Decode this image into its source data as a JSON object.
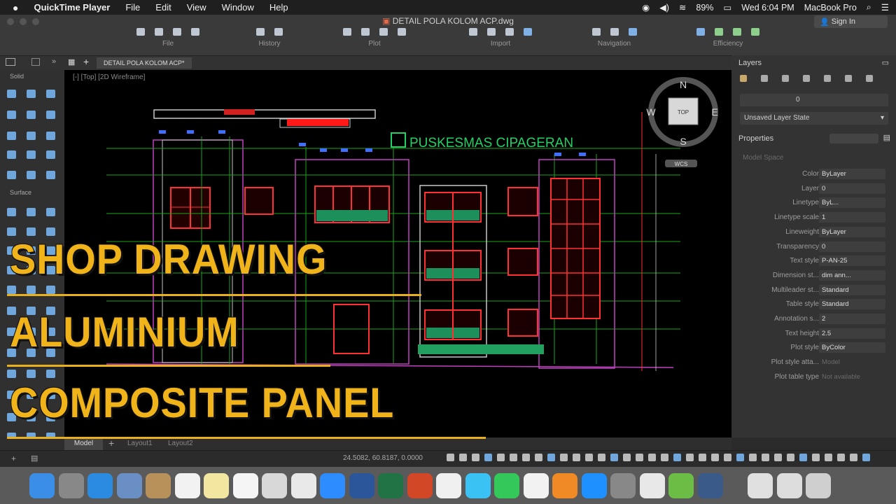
{
  "menubar": {
    "apple": "",
    "app_name": "QuickTime Player",
    "items": [
      "File",
      "Edit",
      "View",
      "Window",
      "Help"
    ],
    "battery": "89%",
    "clock": "Wed 6:04 PM",
    "computer": "MacBook Pro"
  },
  "window": {
    "title": "DETAIL POLA KOLOM ACP.dwg",
    "signin": "Sign In"
  },
  "toolbar": {
    "groups": [
      "File",
      "History",
      "Plot",
      "Import",
      "Navigation",
      "Efficiency"
    ]
  },
  "tabs": {
    "document": "DETAIL POLA KOLOM ACP*"
  },
  "viewport": {
    "label": "[-] [Top] [2D Wireframe]",
    "building_sign": "PUSKESMAS CIPAGERAN",
    "viewcube": {
      "n": "N",
      "s": "S",
      "e": "E",
      "w": "W",
      "top": "TOP"
    },
    "wcs": "WCS"
  },
  "left_palette": {
    "solid": "Solid",
    "surface": "Surface"
  },
  "layers_panel": {
    "title": "Layers",
    "current_layer": "0",
    "layer_state": "Unsaved Layer State"
  },
  "properties_panel": {
    "title": "Properties",
    "model_space": "Model Space",
    "rows": [
      {
        "label": "Color",
        "value": "ByLayer",
        "disabled": false
      },
      {
        "label": "Layer",
        "value": "0",
        "disabled": false
      },
      {
        "label": "Linetype",
        "value": "ByL...",
        "disabled": false
      },
      {
        "label": "Linetype scale",
        "value": "1",
        "disabled": false
      },
      {
        "label": "Lineweight",
        "value": "ByLayer",
        "disabled": false
      },
      {
        "label": "Transparency",
        "value": "0",
        "disabled": false
      },
      {
        "label": "Text style",
        "value": "P-AN-25",
        "disabled": false
      },
      {
        "label": "Dimension st...",
        "value": "dim ann...",
        "disabled": false
      },
      {
        "label": "Multileader st...",
        "value": "Standard",
        "disabled": false
      },
      {
        "label": "Table style",
        "value": "Standard",
        "disabled": false
      },
      {
        "label": "Annotation s...",
        "value": "2",
        "disabled": false
      },
      {
        "label": "Text height",
        "value": "2.5",
        "disabled": false
      },
      {
        "label": "Plot style",
        "value": "ByColor",
        "disabled": false
      },
      {
        "label": "Plot style atta...",
        "value": "Model",
        "disabled": true
      },
      {
        "label": "Plot table type",
        "value": "Not available",
        "disabled": true
      }
    ]
  },
  "layout_tabs": [
    "Model",
    "Layout1",
    "Layout2"
  ],
  "status": {
    "coordinates": "24.5082, 60.8187, 0.0000"
  },
  "overlay": {
    "line1": "SHOP DRAWING",
    "line2": "ALUMINIUM",
    "line3": "COMPOSITE PANEL"
  },
  "colors": {
    "overlay_text": "#f0b41a",
    "cad_background": "#000000",
    "panel_bg": "#333333"
  }
}
